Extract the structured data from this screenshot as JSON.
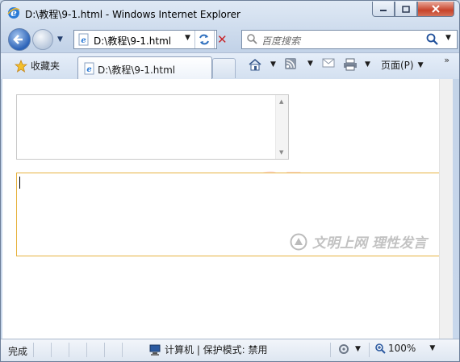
{
  "window": {
    "title": "D:\\教程\\9-1.html - Windows Internet Explorer",
    "app_icon": "ie-icon",
    "colors": {
      "ie_blue": "#2c63b8",
      "close_red": "#c7432a",
      "focus_border": "#e7b340"
    }
  },
  "address_bar": {
    "url": "D:\\教程\\9-1.html",
    "dropdown_icon": "chevron-down-icon"
  },
  "search": {
    "placeholder": "百度搜索"
  },
  "tabs": {
    "favorites_label": "收藏夹",
    "active_tab_label": "D:\\教程\\9-1.html"
  },
  "command_bar": {
    "page_label": "页面(P)",
    "overflow": "»"
  },
  "content": {
    "watermark": "www.aa25.cn",
    "watermark_brand": "文明上网 理性发言"
  },
  "status": {
    "done": "完成",
    "zone": "计算机 | 保护模式: 禁用",
    "zoom": "100%"
  }
}
